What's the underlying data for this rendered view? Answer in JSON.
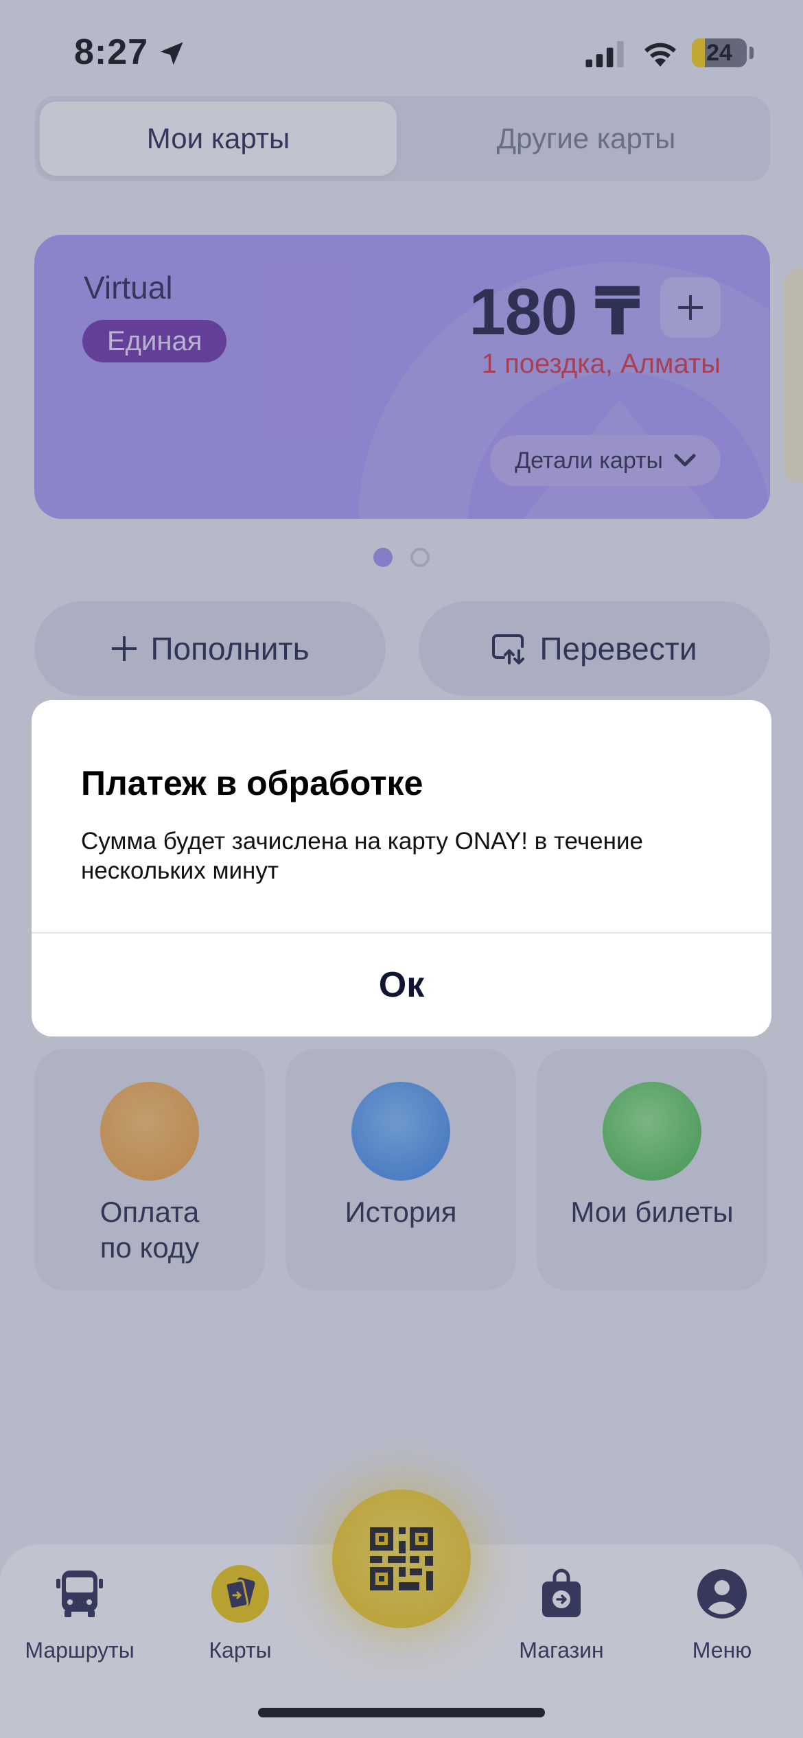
{
  "status_bar": {
    "time": "8:27",
    "battery_level": "24",
    "battery_fraction": 0.24
  },
  "tabs": [
    {
      "label": "Мои карты",
      "active": true
    },
    {
      "label": "Другие карты",
      "active": false
    }
  ],
  "card": {
    "name": "Virtual",
    "badge": "Единая",
    "balance": "180 ₸",
    "trips": "1 поездка, Алматы",
    "details_label": "Детали карты",
    "add_icon": "plus-icon",
    "color": "#a999f8"
  },
  "pager": {
    "count": 2,
    "active_index": 0
  },
  "actions": {
    "topup_label": "Пополнить",
    "transfer_label": "Перевести"
  },
  "tiles": [
    {
      "label": "Оплата\nпо коду",
      "icon": "code-payment-icon"
    },
    {
      "label": "История",
      "icon": "history-icon"
    },
    {
      "label": "Мои билеты",
      "icon": "tickets-icon"
    }
  ],
  "alert": {
    "title": "Платеж в обработке",
    "message": "Сумма будет зачислена на карту ONAY! в течение нескольких минут",
    "ok_label": "Ок"
  },
  "bottom_nav": [
    {
      "label": "Маршруты",
      "icon": "bus-icon"
    },
    {
      "label": "Карты",
      "icon": "cards-icon"
    },
    {
      "label": "Магазин",
      "icon": "shop-bag-icon"
    },
    {
      "label": "Меню",
      "icon": "profile-icon"
    }
  ],
  "colors": {
    "accent_yellow": "#f3c400",
    "trips_red": "#d62b3c",
    "badge_purple": "#6a2aa6"
  }
}
